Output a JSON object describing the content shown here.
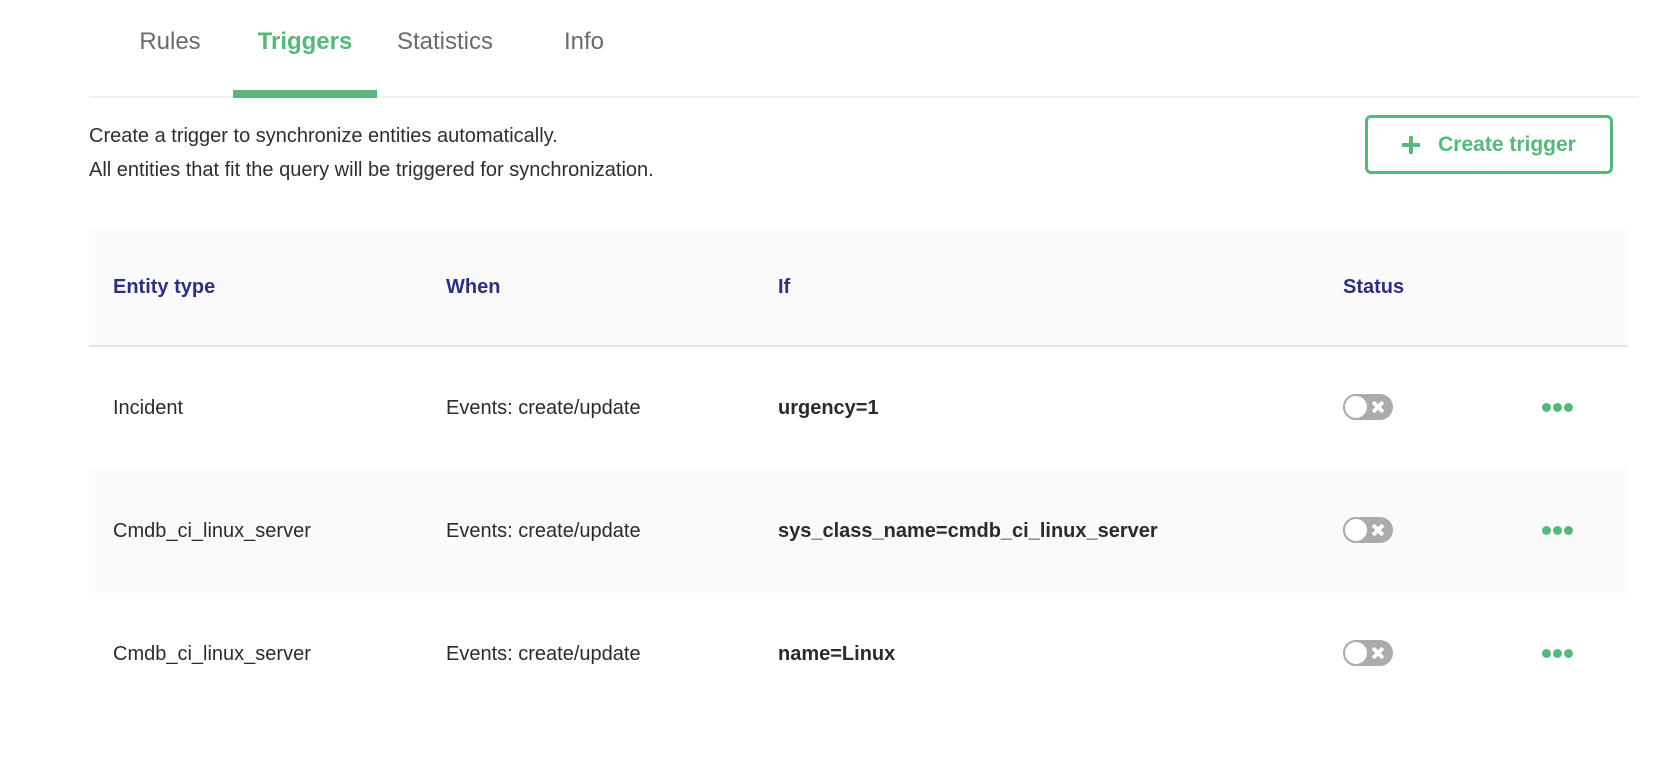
{
  "tabs": [
    {
      "label": "Rules",
      "active": false
    },
    {
      "label": "Triggers",
      "active": true
    },
    {
      "label": "Statistics",
      "active": false
    },
    {
      "label": "Info",
      "active": false
    }
  ],
  "description": {
    "line1": "Create a trigger to synchronize entities automatically.",
    "line2": "All entities that fit the query will be triggered for synchronization."
  },
  "create_button": {
    "label": "Create trigger",
    "icon": "plus-icon"
  },
  "colors": {
    "accent": "#56b87a",
    "header_text": "#2f2f7f",
    "toggle_off": "#ababab"
  },
  "table": {
    "columns": [
      "Entity type",
      "When",
      "If",
      "Status"
    ],
    "rows": [
      {
        "entity_type": "Incident",
        "when": "Events: create/update",
        "if": "urgency=1",
        "status": "off"
      },
      {
        "entity_type": "Cmdb_ci_linux_server",
        "when": "Events: create/update",
        "if": "sys_class_name=cmdb_ci_linux_server",
        "status": "off"
      },
      {
        "entity_type": "Cmdb_ci_linux_server",
        "when": "Events: create/update",
        "if": "name=Linux",
        "status": "off"
      }
    ]
  }
}
